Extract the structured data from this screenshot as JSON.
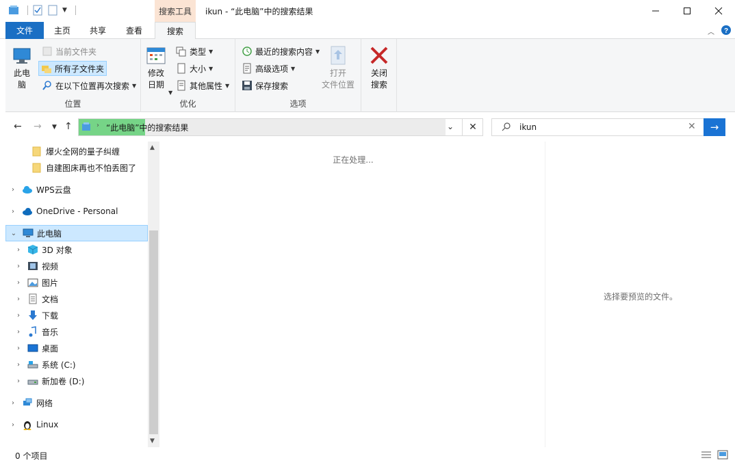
{
  "window": {
    "title": "ikun - “此电脑”中的搜索结果",
    "context_tab_label": "搜索工具"
  },
  "tabs": {
    "file": "文件",
    "home": "主页",
    "share": "共享",
    "view": "查看",
    "search": "搜索"
  },
  "ribbon": {
    "location": {
      "this_pc": "此电\n脑",
      "current_folder": "当前文件夹",
      "all_subfolders": "所有子文件夹",
      "search_again_in": "在以下位置再次搜索",
      "label": "位置"
    },
    "refine": {
      "date_modified": "修改\n日期",
      "kind": "类型",
      "size": "大小",
      "other_properties": "其他属性",
      "label": "优化"
    },
    "options": {
      "recent_searches": "最近的搜索内容",
      "advanced_options": "高级选项",
      "save_search": "保存搜索",
      "open_file_location": "打开\n文件位置",
      "label": "选项"
    },
    "close": {
      "close_search": "关闭\n搜索"
    }
  },
  "address": {
    "path_text": "“此电脑”中的搜索结果",
    "progress": 0.18
  },
  "search": {
    "value": "ikun"
  },
  "nav": {
    "items": [
      {
        "label": "爆火全网的量子纠缠",
        "icon": "folder-icon"
      },
      {
        "label": "自建图床再也不怕丢图了",
        "icon": "folder-icon"
      },
      {
        "label": "WPS云盘",
        "icon": "cloud-icon"
      },
      {
        "label": "OneDrive - Personal",
        "icon": "onedrive-icon"
      },
      {
        "label": "此电脑",
        "icon": "computer-icon"
      },
      {
        "label": "3D 对象",
        "icon": "cube-icon"
      },
      {
        "label": "视频",
        "icon": "video-icon"
      },
      {
        "label": "图片",
        "icon": "picture-icon"
      },
      {
        "label": "文档",
        "icon": "document-icon"
      },
      {
        "label": "下载",
        "icon": "download-icon"
      },
      {
        "label": "音乐",
        "icon": "music-icon"
      },
      {
        "label": "桌面",
        "icon": "desktop-icon"
      },
      {
        "label": "系统 (C:)",
        "icon": "drive-c-icon"
      },
      {
        "label": "新加卷 (D:)",
        "icon": "drive-d-icon"
      },
      {
        "label": "网络",
        "icon": "network-icon"
      },
      {
        "label": "Linux",
        "icon": "linux-icon"
      }
    ]
  },
  "content": {
    "processing_text": "正在处理..."
  },
  "preview": {
    "empty_text": "选择要预览的文件。"
  },
  "status": {
    "item_count": "0 个项目"
  },
  "colors": {
    "accent": "#1a6fc4",
    "context_tab": "#fbe4d4",
    "selection": "#cce8ff",
    "progress": "#06b025"
  }
}
